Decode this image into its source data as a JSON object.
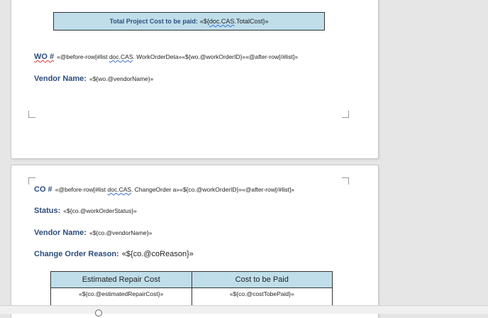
{
  "page1": {
    "total_label": "Total Project Cost to be paid:",
    "total_prefix": "«${",
    "total_doc": "doc.CAS",
    "total_suffix": ".TotalCost}»",
    "wo_label": "WO #",
    "wo_prefix": "«@before-row[#list ",
    "wo_doc": "doc.CAS",
    "wo_suffix": ". WorkOrderDeta»«${wo.@workOrderID}»«@after-row[/#list]»",
    "vendor_label": "Vendor Name:",
    "vendor_value": "«${wo.@vendorName}»"
  },
  "page2": {
    "co_label": "CO #",
    "co_prefix": "«@before-row[#list ",
    "co_doc": "doc.CAS",
    "co_suffix": ". ChangeOrder a»«${co.@workOrderID}»«@after-row[/#list]»",
    "status_label": "Status:",
    "status_value": "«${co.@workOrderStatus}»",
    "vendor_label": "Vendor Name:",
    "vendor_value": "«${co.@vendorName}»",
    "reason_label": "Change Order Reason:",
    "reason_value": "«${co.@coReason}»",
    "table": {
      "headers": [
        "Estimated Repair Cost",
        "Cost to be Paid"
      ],
      "row": [
        "«${co.@estimatedRepairCost}»",
        "«${co.@costTobePaid}»"
      ]
    }
  },
  "colors": {
    "label": "#2b4c7e",
    "box_fill": "#bfdeea",
    "spell_error": "#d9342b"
  }
}
